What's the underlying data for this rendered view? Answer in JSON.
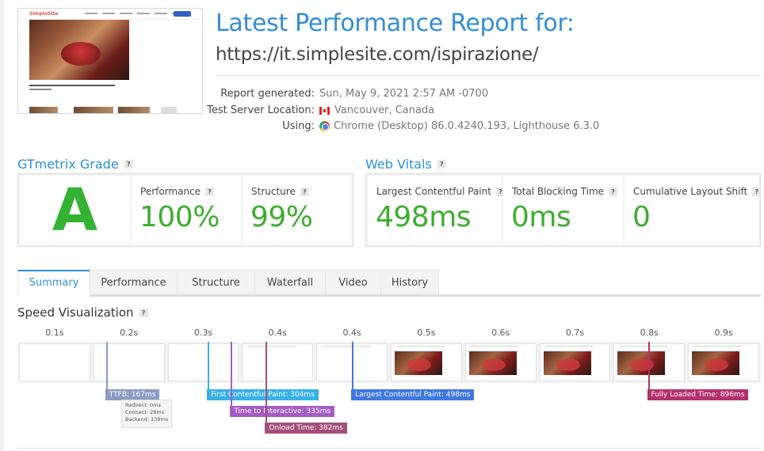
{
  "header": {
    "title": "Latest Performance Report for:",
    "url": "https://it.simplesite.com/ispirazione/",
    "thumbnail": {
      "logo": "SimpleSite"
    },
    "meta": [
      {
        "label": "Report generated:",
        "value": "Sun, May 9, 2021 2:57 AM -0700",
        "icon": ""
      },
      {
        "label": "Test Server Location:",
        "value": "Vancouver, Canada",
        "icon": "canada-flag-icon"
      },
      {
        "label": "Using:",
        "value": "Chrome (Desktop) 86.0.4240.193, Lighthouse 6.3.0",
        "icon": "chrome-icon"
      }
    ]
  },
  "gtmetrix": {
    "heading": "GTmetrix Grade",
    "grade": "A",
    "performance_label": "Performance",
    "performance_value": "100%",
    "structure_label": "Structure",
    "structure_value": "99%"
  },
  "web_vitals": {
    "heading": "Web Vitals",
    "lcp_label": "Largest Contentful Paint",
    "lcp_value": "498ms",
    "tbt_label": "Total Blocking Time",
    "tbt_value": "0ms",
    "cls_label": "Cumulative Layout Shift",
    "cls_value": "0"
  },
  "help_glyph": "?",
  "tabs": [
    {
      "label": "Summary",
      "active": true
    },
    {
      "label": "Performance",
      "active": false
    },
    {
      "label": "Structure",
      "active": false
    },
    {
      "label": "Waterfall",
      "active": false
    },
    {
      "label": "Video",
      "active": false
    },
    {
      "label": "History",
      "active": false
    }
  ],
  "speed_visualization": {
    "heading": "Speed Visualization",
    "ticks": [
      "0.1s",
      "0.2s",
      "0.3s",
      "0.4s",
      "0.4s",
      "0.5s",
      "0.6s",
      "0.7s",
      "0.8s",
      "0.9s"
    ],
    "frames": [
      "blank",
      "blank",
      "blank",
      "partial",
      "partial",
      "loaded",
      "loaded",
      "loaded",
      "loaded",
      "loaded"
    ],
    "timeline_max_ms": 1000,
    "markers": [
      {
        "label": "TTFB: 167ms",
        "time_ms": 167,
        "color": "#8a9cc3"
      },
      {
        "label": "First Contentful Paint: 304ms",
        "time_ms": 304,
        "color": "#38b1e8"
      },
      {
        "label": "Time to Interactive: 335ms",
        "time_ms": 335,
        "color": "#a45bc4"
      },
      {
        "label": "Onload Time: 382ms",
        "time_ms": 382,
        "color": "#a34f79"
      },
      {
        "label": "Largest Contentful Paint: 498ms",
        "time_ms": 498,
        "color": "#3f78e0"
      },
      {
        "label": "Fully Loaded Time: 896ms",
        "time_ms": 896,
        "color": "#b3306d"
      }
    ],
    "ttfb_details": [
      "Redirect: 0ms",
      "Connect: 28ms",
      "Backend: 139ms"
    ]
  },
  "colors": {
    "accent": "#2f8fd8",
    "grade_green": "#33b233",
    "value_green": "#3cae2e"
  }
}
